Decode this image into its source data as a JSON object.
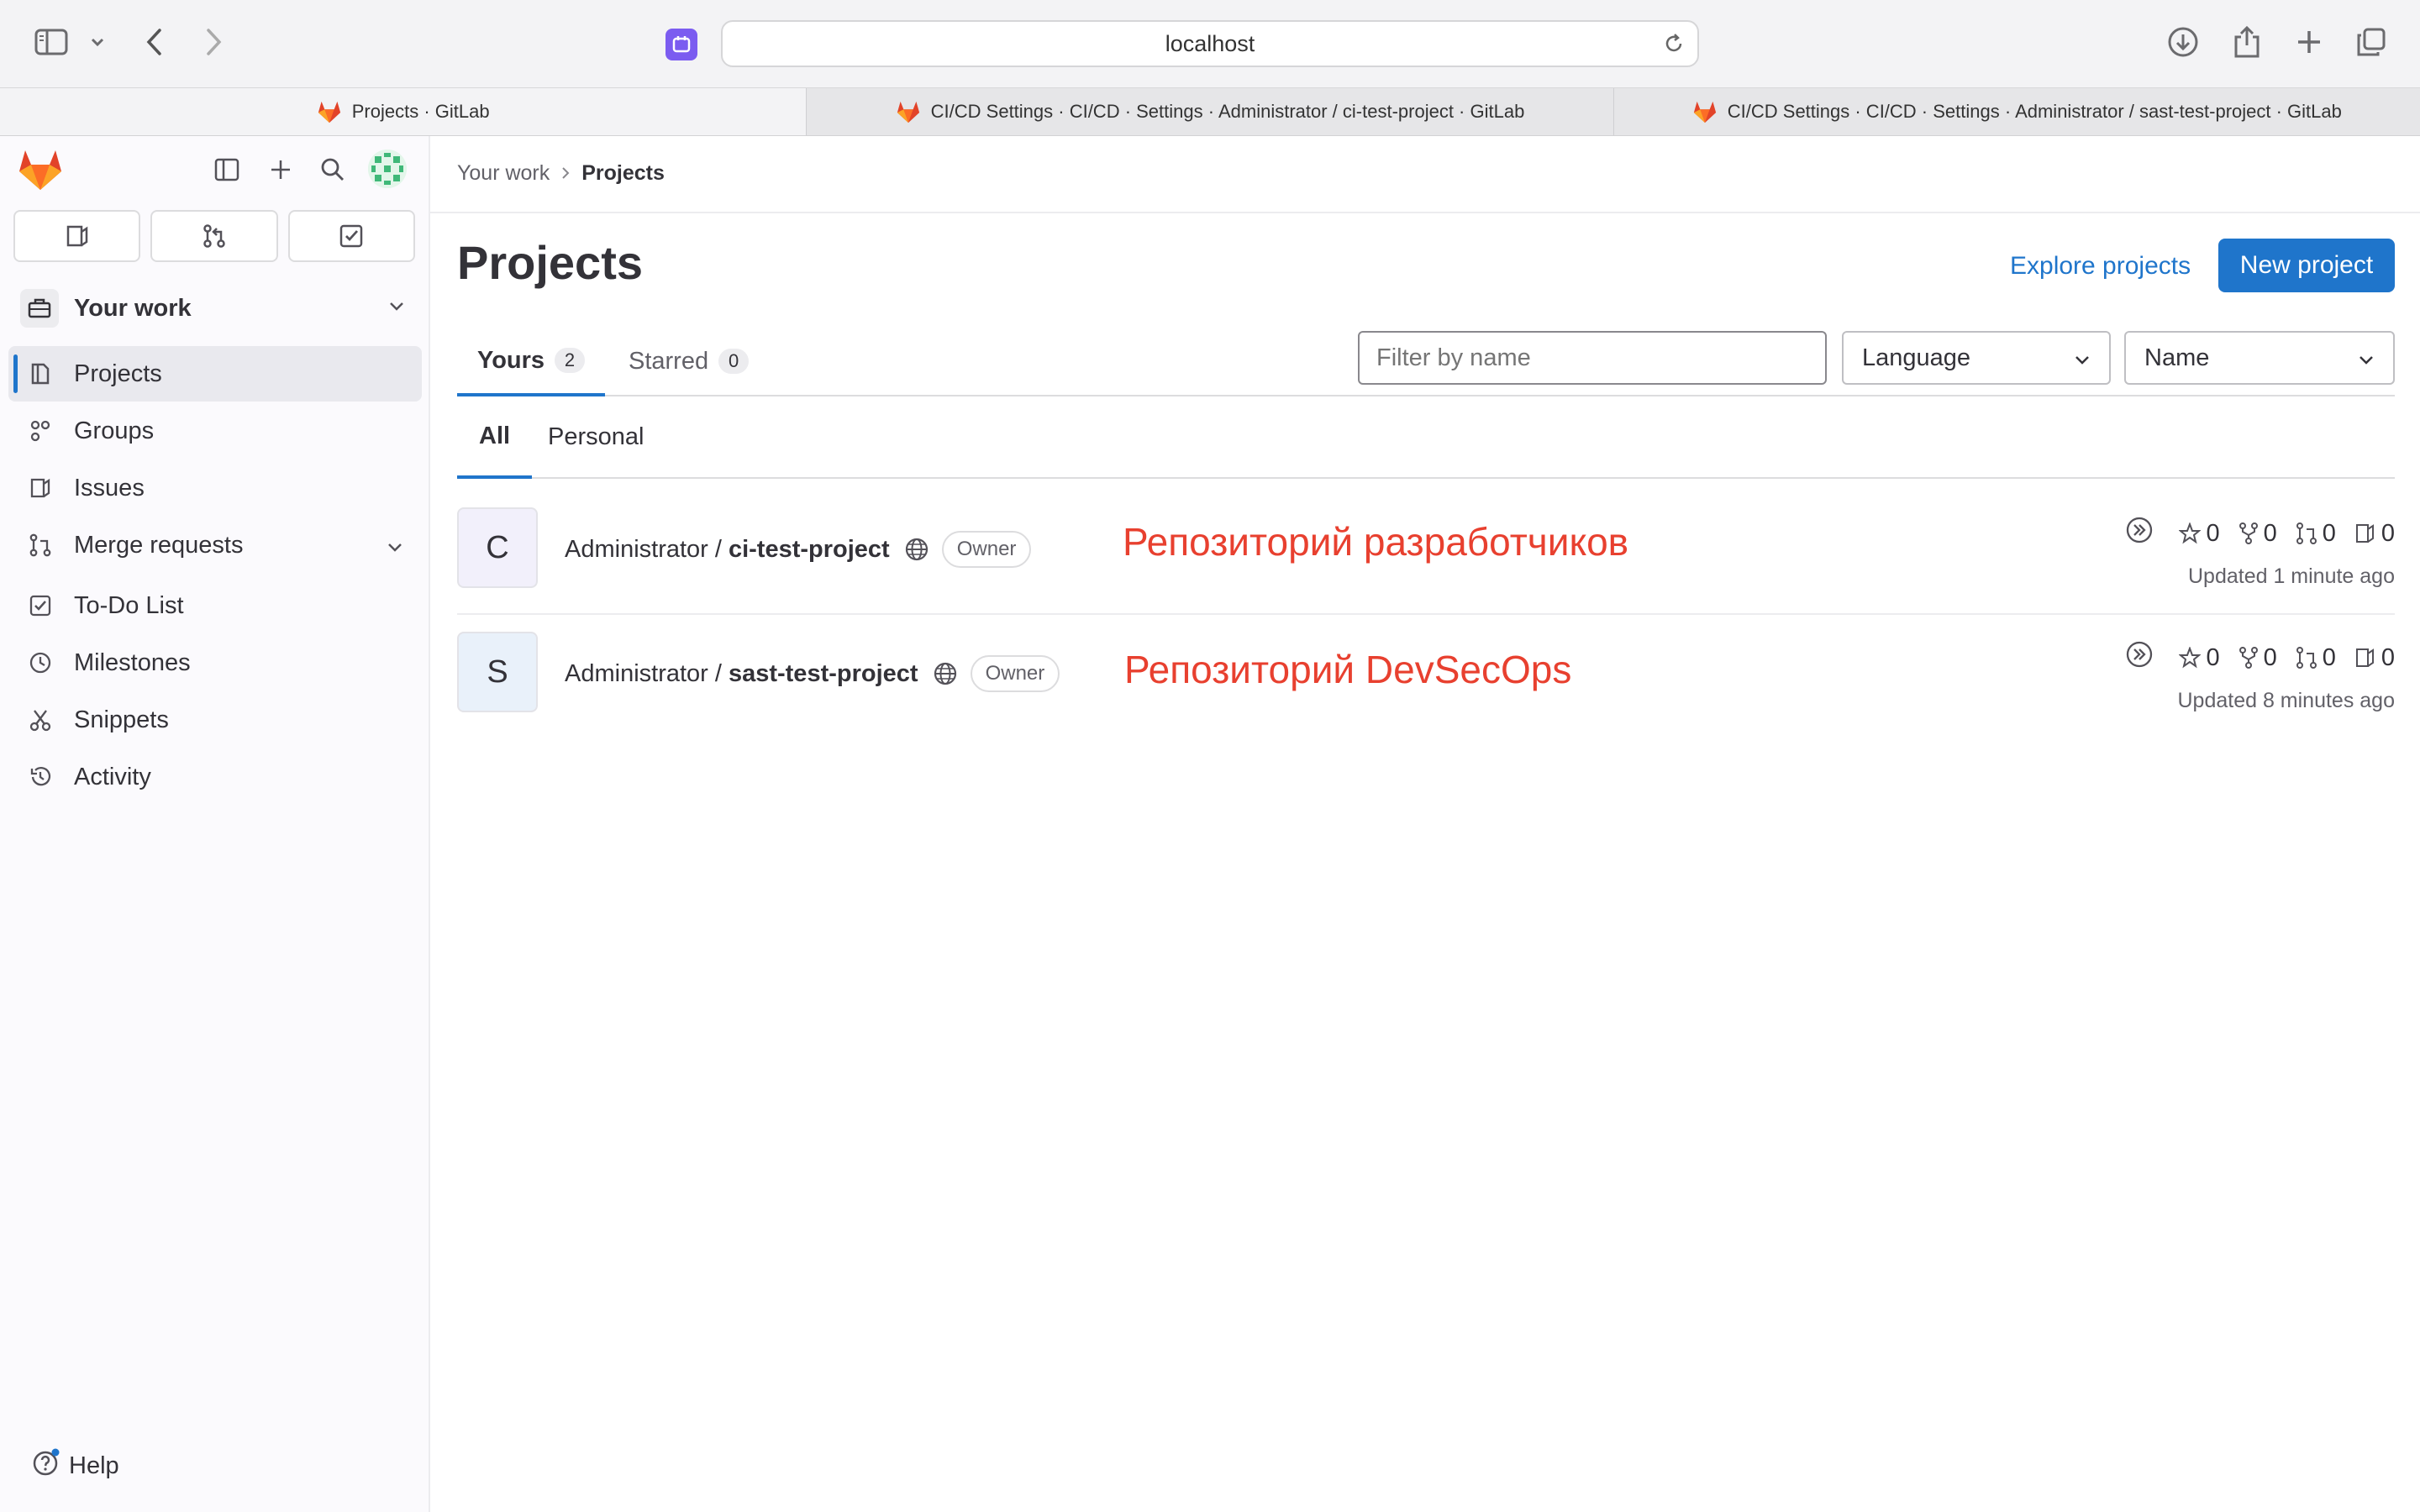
{
  "browser": {
    "url": "localhost",
    "tabs": [
      {
        "title": "Projects · GitLab"
      },
      {
        "title": "CI/CD Settings · CI/CD · Settings · Administrator / ci-test-project · GitLab"
      },
      {
        "title": "CI/CD Settings · CI/CD · Settings · Administrator / sast-test-project · GitLab"
      }
    ]
  },
  "sidebar": {
    "context_title": "Your work",
    "items": [
      {
        "label": "Projects",
        "icon": "project-icon",
        "active": true
      },
      {
        "label": "Groups",
        "icon": "group-icon"
      },
      {
        "label": "Issues",
        "icon": "issues-icon"
      },
      {
        "label": "Merge requests",
        "icon": "merge-request-icon"
      },
      {
        "label": "To-Do List",
        "icon": "todo-icon"
      },
      {
        "label": "Milestones",
        "icon": "clock-icon"
      },
      {
        "label": "Snippets",
        "icon": "snippet-icon"
      },
      {
        "label": "Activity",
        "icon": "history-icon"
      }
    ],
    "help_label": "Help"
  },
  "main": {
    "breadcrumb": [
      "Your work",
      "Projects"
    ],
    "title": "Projects",
    "explore_label": "Explore projects",
    "new_project_label": "New project",
    "tabs": [
      {
        "label": "Yours",
        "count": "2"
      },
      {
        "label": "Starred",
        "count": "0"
      }
    ],
    "filter_placeholder": "Filter by name",
    "language_label": "Language",
    "sort_label": "Name",
    "subtabs": [
      "All",
      "Personal"
    ],
    "projects": [
      {
        "avatar_letter": "C",
        "namespace": "Administrator /",
        "name": "ci-test-project",
        "role": "Owner",
        "annotation": "Репозиторий разработчиков",
        "stars": "0",
        "forks": "0",
        "merge_requests": "0",
        "issues": "0",
        "updated": "Updated 1 minute ago"
      },
      {
        "avatar_letter": "S",
        "namespace": "Administrator /",
        "name": "sast-test-project",
        "role": "Owner",
        "annotation": "Репозиторий DevSecOps",
        "stars": "0",
        "forks": "0",
        "merge_requests": "0",
        "issues": "0",
        "updated": "Updated 8 minutes ago"
      }
    ]
  },
  "colors": {
    "accent": "#1f75cb",
    "annotation": "#e8402f",
    "sidebar_bg": "#fbfafd"
  }
}
